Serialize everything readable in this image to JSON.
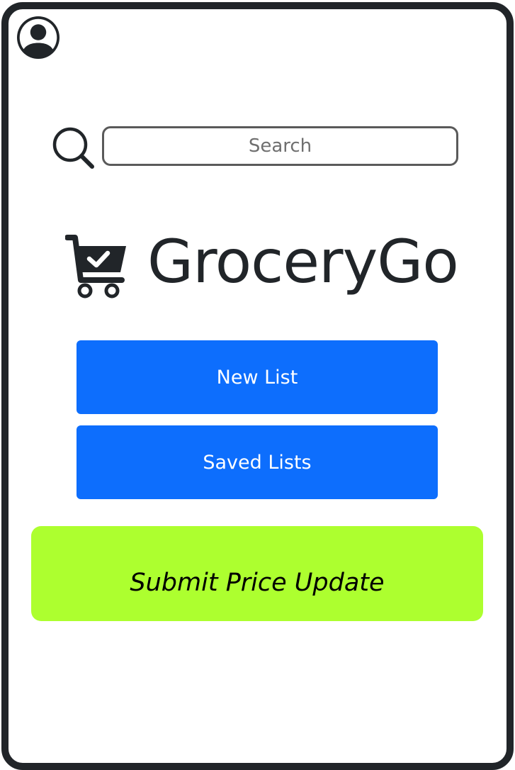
{
  "profile": {
    "icon": "person-circle-icon"
  },
  "search": {
    "icon": "search-icon",
    "placeholder": "Search",
    "value": ""
  },
  "brand": {
    "icon": "cart-check-icon",
    "name": "GroceryGo"
  },
  "actions": {
    "new_list_label": "New List",
    "saved_lists_label": "Saved Lists",
    "submit_price_update_label": "Submit Price Update"
  },
  "colors": {
    "frame": "#212529",
    "primary_button": "#0d6efd",
    "submit_button": "#adff2f",
    "text_dark": "#212529"
  }
}
